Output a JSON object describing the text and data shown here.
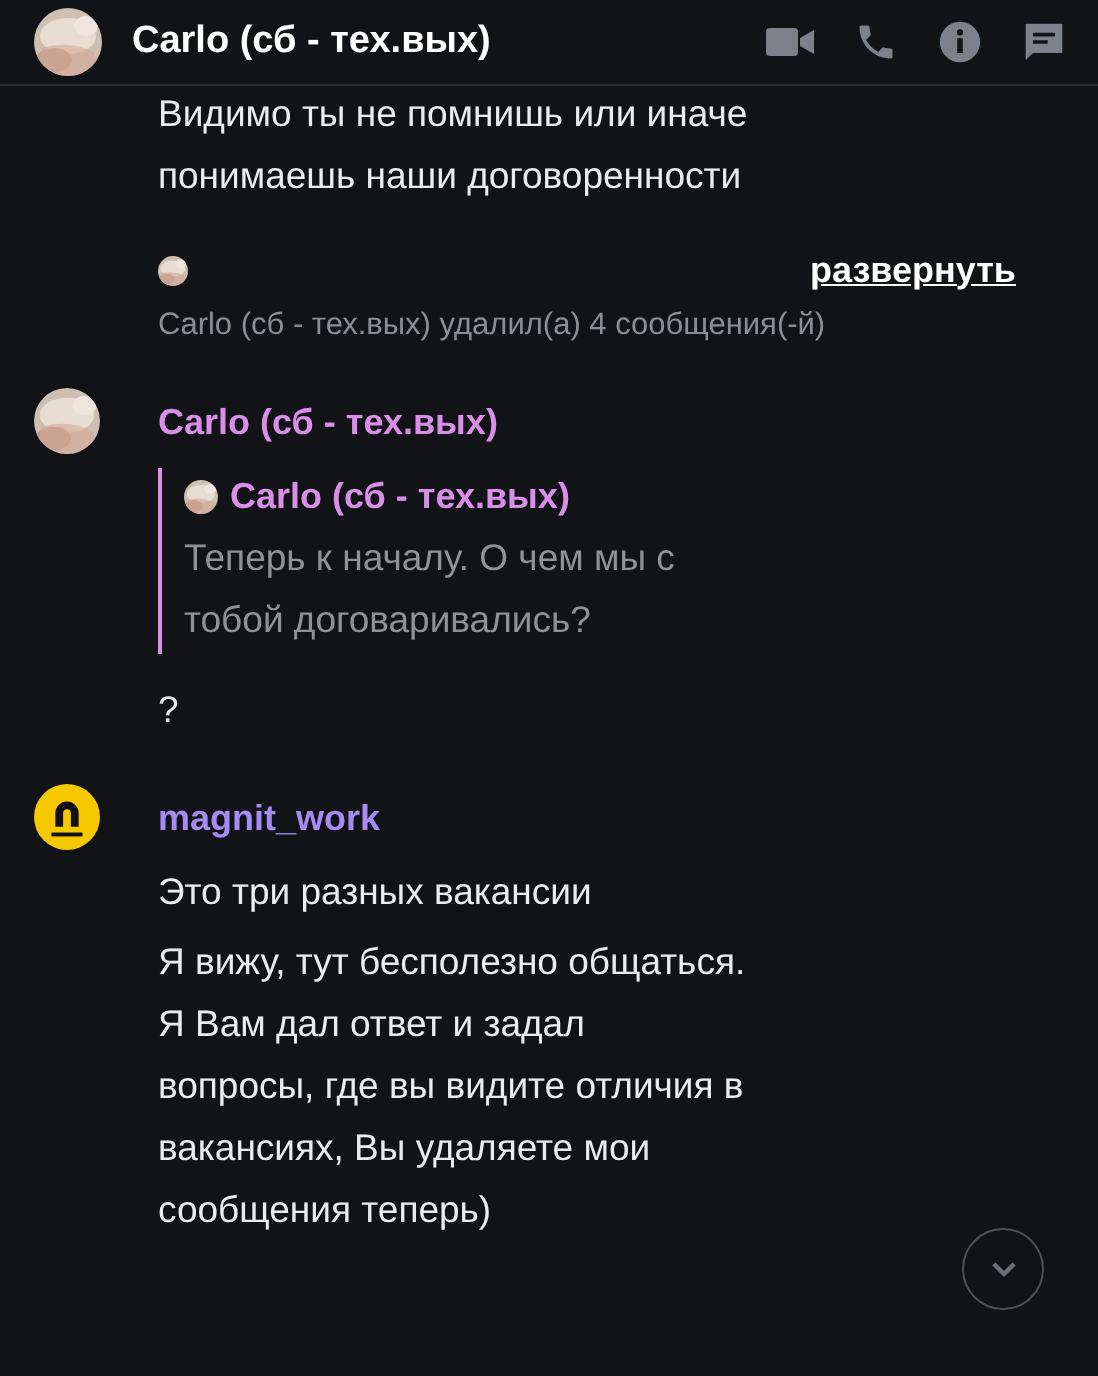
{
  "header": {
    "title": "Carlo (сб - тех.вых)"
  },
  "messages": [
    {
      "kind": "continuation",
      "texts": [
        "Видимо ты не помнишь или иначе понимаешь наши договоренности"
      ]
    },
    {
      "kind": "deleted",
      "expand_link": "развернуть",
      "notice": "Carlo (сб - тех.вых) удалил(а) 4 сообщения(-й)"
    },
    {
      "kind": "message",
      "avatar": {
        "kind": "picture"
      },
      "author": "Carlo (сб - тех.вых)",
      "color": "#d98ee8",
      "reply": {
        "author": "Carlo (сб - тех.вых)",
        "text": "Теперь к началу. О чем мы с тобой договаривались?"
      },
      "texts": [
        "?"
      ]
    },
    {
      "kind": "message",
      "avatar": {
        "kind": "logo"
      },
      "author": "magnit_work",
      "color": "#a48cf4",
      "texts": [
        "Это три разных вакансии",
        "Я вижу, тут бесполезно общаться. Я Вам дал ответ и задал вопросы, где вы видите отличия в вакансиях, Вы удаляете мои сообщения теперь)"
      ]
    }
  ]
}
